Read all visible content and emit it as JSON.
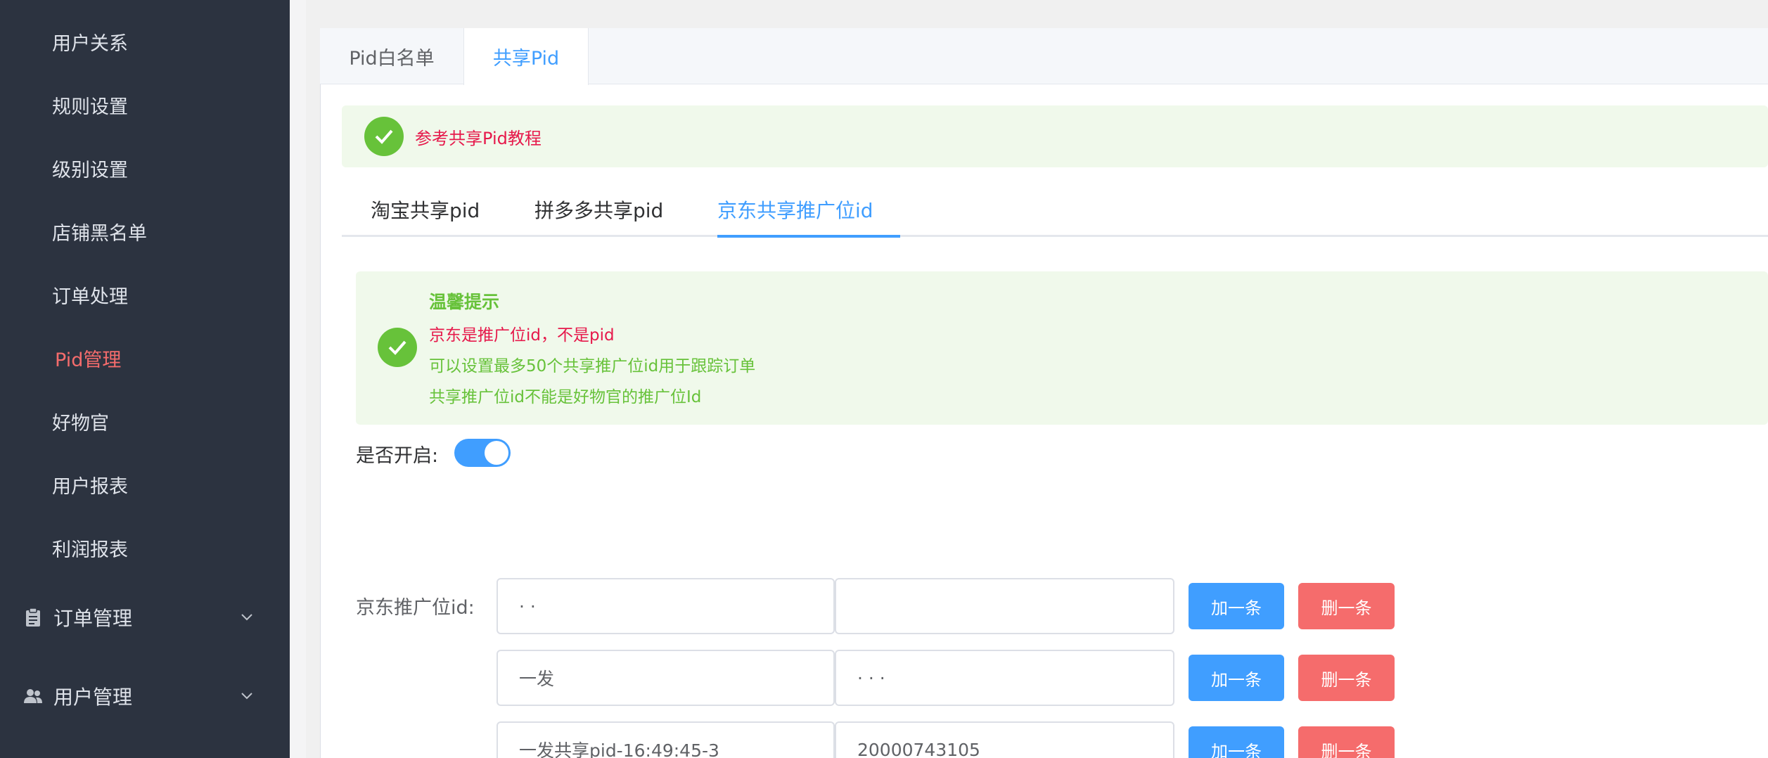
{
  "sidebar": {
    "items": [
      {
        "label": "用户关系"
      },
      {
        "label": "规则设置"
      },
      {
        "label": "级别设置"
      },
      {
        "label": "店铺黑名单"
      },
      {
        "label": "订单处理"
      },
      {
        "label": "Pid管理",
        "active": true
      },
      {
        "label": "好物官"
      },
      {
        "label": "用户报表"
      },
      {
        "label": "利润报表"
      }
    ],
    "groups": [
      {
        "label": "订单管理",
        "icon": "clipboard-icon"
      },
      {
        "label": "用户管理",
        "icon": "users-icon"
      }
    ]
  },
  "tabs": [
    {
      "label": "Pid白名单"
    },
    {
      "label": "共享Pid",
      "active": true
    }
  ],
  "alert": {
    "text": "参考共享Pid教程"
  },
  "subtabs": [
    {
      "label": "淘宝共享pid"
    },
    {
      "label": "拼多多共享pid"
    },
    {
      "label": "京东共享推广位id",
      "active": true
    }
  ],
  "tip": {
    "title": "温馨提示",
    "line1": "京东是推广位id，不是pid",
    "line2": "可以设置最多50个共享推广位id用于跟踪订单",
    "line3": "共享推广位id不能是好物官的推广位Id"
  },
  "switch": {
    "label": "是否开启:",
    "on": true
  },
  "form": {
    "label": "京东推广位id:",
    "add_label": "加一条",
    "delete_label": "删一条",
    "rows": [
      {
        "name": "· ·",
        "id": ""
      },
      {
        "name": "一发",
        "id": "· · ·"
      },
      {
        "name": "一发共享pid-16:49:45-3",
        "id": "20000743105"
      }
    ]
  },
  "colors": {
    "sidebar_bg": "#2c3340",
    "primary": "#409eff",
    "danger": "#f56c6c",
    "success": "#67c23a"
  }
}
